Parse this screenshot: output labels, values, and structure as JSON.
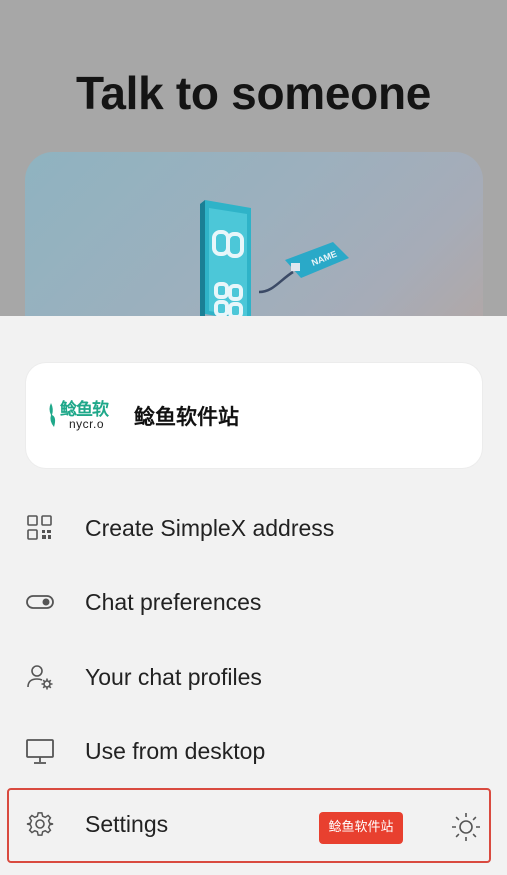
{
  "background": {
    "title": "Talk to someone",
    "illustration": {
      "tag_text": "NAME"
    }
  },
  "profile": {
    "logo": {
      "cn_text": "鲶鱼软",
      "en_text": "nycr.o"
    },
    "name": "鲶鱼软件站"
  },
  "menu": {
    "items": [
      {
        "label": "Create SimpleX address",
        "icon": "qr-code-icon"
      },
      {
        "label": "Chat preferences",
        "icon": "toggle-icon"
      },
      {
        "label": "Your chat profiles",
        "icon": "user-gear-icon"
      },
      {
        "label": "Use from desktop",
        "icon": "desktop-icon"
      },
      {
        "label": "Settings",
        "icon": "gear-icon"
      }
    ]
  },
  "watermark_badge": "鲶鱼软件站",
  "theme_toggle": {
    "icon": "sun-icon"
  },
  "colors": {
    "highlight_border": "#d94a3f",
    "badge_bg": "#e8402f",
    "logo_green": "#1fa88a"
  }
}
